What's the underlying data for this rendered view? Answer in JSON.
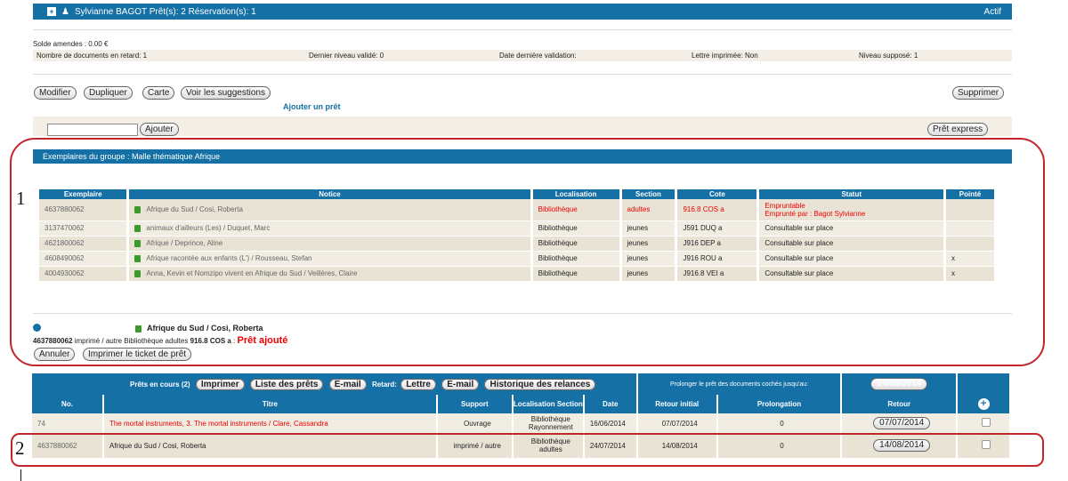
{
  "header": {
    "title": "Sylvianne BAGOT Prêt(s): 2 Réservation(s): 1",
    "status": "Actif"
  },
  "info": {
    "solde": "Solde amendes : 0.00 €",
    "retard": "Nombre de documents en retard: 1",
    "niveau": "Dernier niveau validé: 0",
    "date_validation": "Date dernière validation:",
    "lettre": "Lettre imprimée: Non",
    "niveau_suppose": "Niveau supposé: 1"
  },
  "actions": {
    "modifier": "Modifier",
    "dupliquer": "Dupliquer",
    "carte": "Carte",
    "suggestions": "Voir les suggestions",
    "supprimer": "Supprimer",
    "ajouter_pret": "Ajouter un prêt"
  },
  "pret_form": {
    "input_value": "",
    "ajouter": "Ajouter",
    "express": "Prêt express"
  },
  "group": {
    "title": "Exemplaires du groupe : Malle thématique Afrique",
    "headers": [
      "Exemplaire",
      "Notice",
      "Localisation",
      "Section",
      "Cote",
      "Statut",
      "Pointé"
    ],
    "rows": [
      {
        "ex": "4637880062",
        "notice": "Afrique du Sud / Cosi, Roberta",
        "loc": "Bibliothèque",
        "sec": "adultes",
        "cote": "916.8 COS a",
        "statut": "Empruntable",
        "statut2": "Emprunté par : Bagot Sylvianne",
        "pointe": ""
      },
      {
        "ex": "3137470062",
        "notice": "animaux d'ailleurs (Les) / Duquet, Marc",
        "loc": "Bibliothèque",
        "sec": "jeunes",
        "cote": "J591 DUQ a",
        "statut": "Consultable sur place",
        "statut2": "",
        "pointe": ""
      },
      {
        "ex": "4621800062",
        "notice": "Afrique / Deprince, Aline",
        "loc": "Bibliothèque",
        "sec": "jeunes",
        "cote": "J916 DEP a",
        "statut": "Consultable sur place",
        "statut2": "",
        "pointe": ""
      },
      {
        "ex": "4608490062",
        "notice": "Afrique racontée aux enfants (L') / Rousseau, Stefan",
        "loc": "Bibliothèque",
        "sec": "jeunes",
        "cote": "J916 ROU a",
        "statut": "Consultable sur place",
        "statut2": "",
        "pointe": "x"
      },
      {
        "ex": "4004930062",
        "notice": "Anna, Kevin et Nomzipo vivent en Afrique du Sud / Veillères, Claire",
        "loc": "Bibliothèque",
        "sec": "jeunes",
        "cote": "J916.8 VEI a",
        "statut": "Consultable sur place",
        "statut2": "",
        "pointe": "x"
      }
    ],
    "result_title": "Afrique du Sud / Cosi, Roberta",
    "result_code": "4637880062",
    "result_text": " imprimé / autre Bibliothèque adultes ",
    "result_cote": "916.8 COS a",
    "result_sep": " : ",
    "result_status": "Prêt ajouté",
    "annuler": "Annuler",
    "imprimer_ticket": "Imprimer le ticket de prêt"
  },
  "prets": {
    "title": "Prêts en cours",
    "count": "(2)",
    "imprimer": "Imprimer",
    "liste": "Liste des prêts",
    "email": "E-mail",
    "retard": "Retard:",
    "lettre": "Lettre",
    "email2": "E-mail",
    "historique": "Historique des relances",
    "prolonger_label": "Prolonger le prêt des documents cochés jusqu'au:",
    "prolonger_date": "14/08/2014",
    "headers": [
      "No.",
      "Titre",
      "Support",
      "Localisation Section",
      "Date",
      "Retour initial",
      "Prolongation",
      "Retour"
    ],
    "rows": [
      {
        "no": "74",
        "titre": "The mortal instruments, 3. The mortal instruments / Clare, Cassandra",
        "support": "Ouvrage",
        "loc": "Bibliothèque",
        "sec": "Rayonnement",
        "date": "16/06/2014",
        "initial": "07/07/2014",
        "prol": "0",
        "retour": "07/07/2014"
      },
      {
        "no": "4637880062",
        "titre": "Afrique du Sud / Cosi, Roberta",
        "support": "imprimé / autre",
        "loc": "Bibliothèque",
        "sec": "adultes",
        "date": "24/07/2014",
        "initial": "14/08/2014",
        "prol": "0",
        "retour": "14/08/2014"
      }
    ]
  },
  "annotations": {
    "one": "1",
    "two": "2"
  }
}
